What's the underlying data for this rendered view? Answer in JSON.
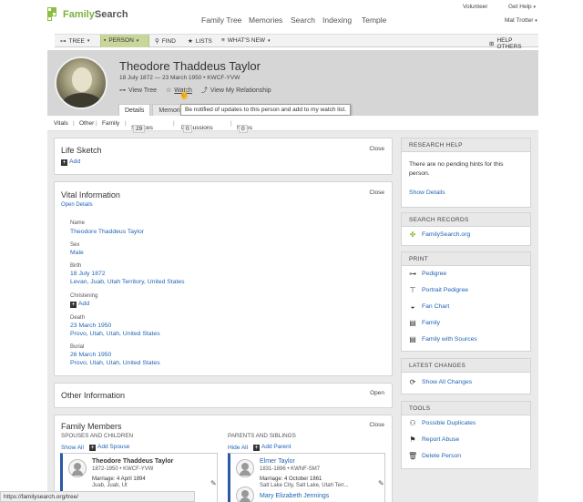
{
  "header": {
    "logo_text_a": "Family",
    "logo_text_b": "Search",
    "volunteer": "Volunteer",
    "get_help": "Get Help",
    "user": "Mat Trotter",
    "nav": [
      "Family Tree",
      "Memories",
      "Search",
      "Indexing",
      "Temple"
    ]
  },
  "treenav": {
    "tree": "TREE",
    "person": "PERSON",
    "find": "FIND",
    "lists": "LISTS",
    "whats_new": "WHAT'S NEW",
    "help_others": "HELP OTHERS"
  },
  "person": {
    "name": "Theodore Thaddeus Taylor",
    "dates": "18 July 1872 — 23 March 1950 • KWCF-YVW",
    "view_tree": "View Tree",
    "watch": "Watch",
    "view_relationship": "View My Relationship",
    "tabs": [
      "Details",
      "Memories"
    ],
    "tooltip": "Be notified of updates to this person and add to my watch list."
  },
  "subnav": {
    "vitals": "Vitals",
    "other": "Other",
    "family": "Family",
    "sources": "Sources",
    "sources_count": "29",
    "discussions": "Discussions",
    "discussions_count": "0",
    "notes": "Notes",
    "notes_count": "0"
  },
  "life_sketch": {
    "title": "Life Sketch",
    "close": "Close",
    "add": "Add"
  },
  "vital": {
    "title": "Vital Information",
    "close": "Close",
    "open_details": "Open Details",
    "name_label": "Name",
    "name": "Theodore Thaddeus Taylor",
    "sex_label": "Sex",
    "sex": "Male",
    "birth_label": "Birth",
    "birth_date": "18 July 1872",
    "birth_place": "Levan, Juab, Utah Territory, United States",
    "christening_label": "Christening",
    "christening_add": "Add",
    "death_label": "Death",
    "death_date": "23 March 1950",
    "death_place": "Provo, Utah, Utah, United States",
    "burial_label": "Burial",
    "burial_date": "26 March 1950",
    "burial_place": "Provo, Utah, Utah, United States"
  },
  "other_info": {
    "title": "Other Information",
    "open": "Open"
  },
  "family": {
    "title": "Family Members",
    "close": "Close",
    "spouses_heading": "SPOUSES AND CHILDREN",
    "show_all": "Show All",
    "add_spouse": "Add Spouse",
    "parents_heading": "PARENTS AND SIBLINGS",
    "hide_all": "Hide All",
    "add_parent": "Add Parent",
    "self_name": "Theodore Thaddeus Taylor",
    "self_meta": "1872-1950 • KWCF-YVW",
    "marriage1": "Marriage: 4 April 1894",
    "marriage1_place": "Juab, Juab, Ut",
    "father_name": "Elmer Taylor",
    "father_meta": "1831-1896 • KWNF-SM7",
    "marriage2": "Marriage: 4 October 1861",
    "marriage2_place": "Salt Lake City, Salt Lake, Utah Terr...",
    "mother_name": "Mary Elizabeth Jennings",
    "mother_meta": "1841-1919 • KWNF-SM7"
  },
  "research_help": {
    "title": "RESEARCH HELP",
    "text": "There are no pending hints for this person.",
    "show_details": "Show Details"
  },
  "search_records": {
    "title": "SEARCH RECORDS",
    "item": "FamilySearch.org"
  },
  "print": {
    "title": "PRINT",
    "items": [
      "Pedigree",
      "Portrait Pedigree",
      "Fan Chart",
      "Family",
      "Family with Sources"
    ]
  },
  "latest_changes": {
    "title": "LATEST CHANGES",
    "item": "Show All Changes"
  },
  "tools": {
    "title": "TOOLS",
    "items": [
      "Possible Duplicates",
      "Report Abuse",
      "Delete Person"
    ]
  },
  "statusbar": "https://familysearch.org/tree/",
  "colors": {
    "accent_green": "#8cbe3f",
    "link_blue": "#1f63b5",
    "header_grey": "#d6d6d6"
  }
}
